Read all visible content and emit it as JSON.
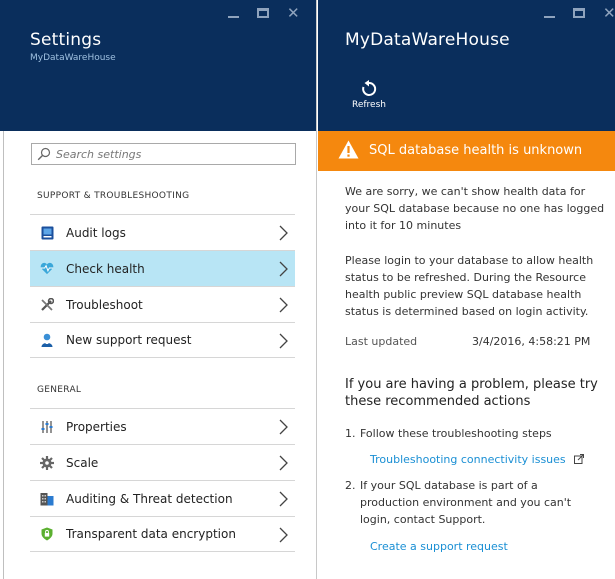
{
  "settings_blade": {
    "title": "Settings",
    "subtitle": "MyDataWareHouse",
    "search": {
      "placeholder": "Search settings",
      "value": ""
    },
    "sections": [
      {
        "label": "SUPPORT & TROUBLESHOOTING",
        "items": [
          {
            "label": "Audit logs",
            "icon": "audit-log-icon",
            "selected": false
          },
          {
            "label": "Check health",
            "icon": "heart-health-icon",
            "selected": true
          },
          {
            "label": "Troubleshoot",
            "icon": "wrench-icon",
            "selected": false
          },
          {
            "label": "New support request",
            "icon": "support-person-icon",
            "selected": false
          }
        ]
      },
      {
        "label": "GENERAL",
        "items": [
          {
            "label": "Properties",
            "icon": "properties-sliders-icon",
            "selected": false
          },
          {
            "label": "Scale",
            "icon": "gear-icon",
            "selected": false
          },
          {
            "label": "Auditing & Threat detection",
            "icon": "auditing-building-icon",
            "selected": false
          },
          {
            "label": "Transparent data encryption",
            "icon": "shield-lock-icon",
            "selected": false
          }
        ]
      }
    ]
  },
  "health_blade": {
    "title": "MyDataWareHouse",
    "refresh_label": "Refresh",
    "banner": {
      "text": "SQL database health is unknown",
      "color": "#f5880e"
    },
    "paragraph1": "We are sorry, we can't show health data for your SQL database because no one has logged into it for 10 minutes",
    "paragraph2": "Please login to your database to allow health status to be refreshed. During the Resource health public preview SQL database health status is determined based on login activity.",
    "last_updated_label": "Last updated",
    "last_updated_value": "3/4/2016, 4:58:21 PM",
    "recommend_heading": "If you are having a problem, please try these recommended actions",
    "steps": [
      {
        "number": "1.",
        "text": "Follow these troubleshooting steps",
        "link": "Troubleshooting connectivity issues"
      },
      {
        "number": "2.",
        "text": "If your SQL database is part of a production environment and you can't login, contact Support.",
        "link": "Create a support request"
      }
    ]
  },
  "colors": {
    "header_bg": "#0a2e5c",
    "selected_bg": "#b8e5f5",
    "link": "#1a8fd4",
    "warning": "#f5880e"
  }
}
